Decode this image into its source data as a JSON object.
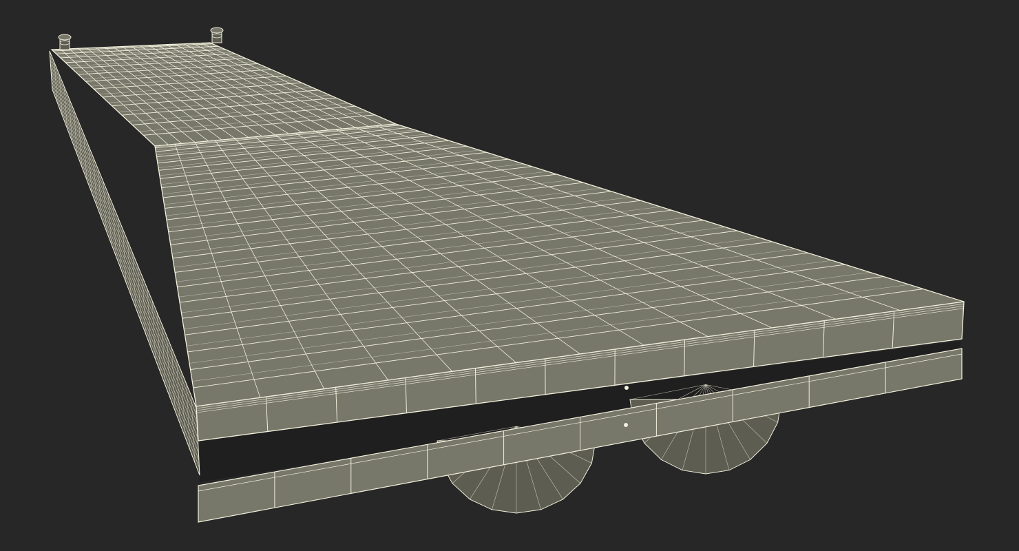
{
  "scene": {
    "subject": "floating-dock-wireframe",
    "colors": {
      "background": "#272727",
      "surface": "#77776a",
      "surface_dark": "#5d5d52",
      "wire": "#f2f0dc",
      "gap": "#1f1f1f"
    }
  }
}
